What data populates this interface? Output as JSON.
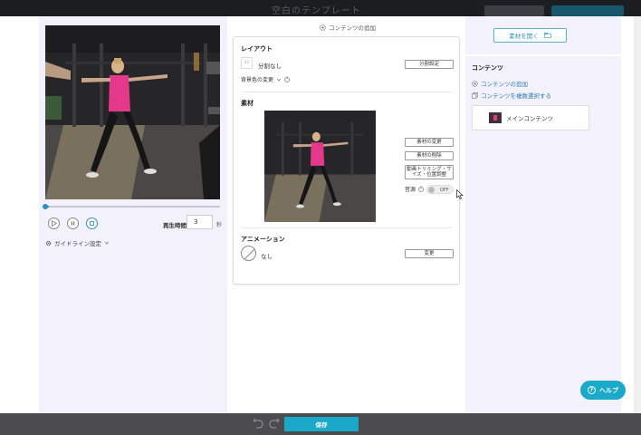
{
  "header": {
    "title": "空白のテンプレート"
  },
  "player": {
    "progress": 0.02,
    "play_time_label": "再生時間",
    "play_time_value": "3",
    "play_time_unit": "秒",
    "guideline_label": "ガイドライン設定"
  },
  "editor": {
    "add_content": "コンテンツの追加",
    "layout": {
      "title": "レイアウト",
      "icon_text": "S1",
      "value": "分割なし",
      "settings_button": "分割設定",
      "bg_change": "背景色の変更"
    },
    "material": {
      "title": "素材",
      "change_button": "素材の変更",
      "delete_button": "素材の削除",
      "trim_button": "動画トリミング・サイズ・位置調整",
      "audio_label": "音源",
      "audio_toggle": "OFF"
    },
    "animation": {
      "title": "アニメーション",
      "value": "なし",
      "change_button": "変更"
    }
  },
  "sidebar": {
    "open_material_button": "素材を開く",
    "contents_title": "コンテンツ",
    "add_content_link": "コンテンツの追加",
    "multi_select_link": "コンテンツを複数選択する",
    "items": [
      {
        "label": "メインコンテンツ"
      }
    ]
  },
  "footer": {
    "save_button": "保存"
  },
  "help_button": "ヘルプ",
  "colors": {
    "accent": "#1aa9c9",
    "link": "#2b7cb0",
    "shirt": "#e4388b"
  }
}
